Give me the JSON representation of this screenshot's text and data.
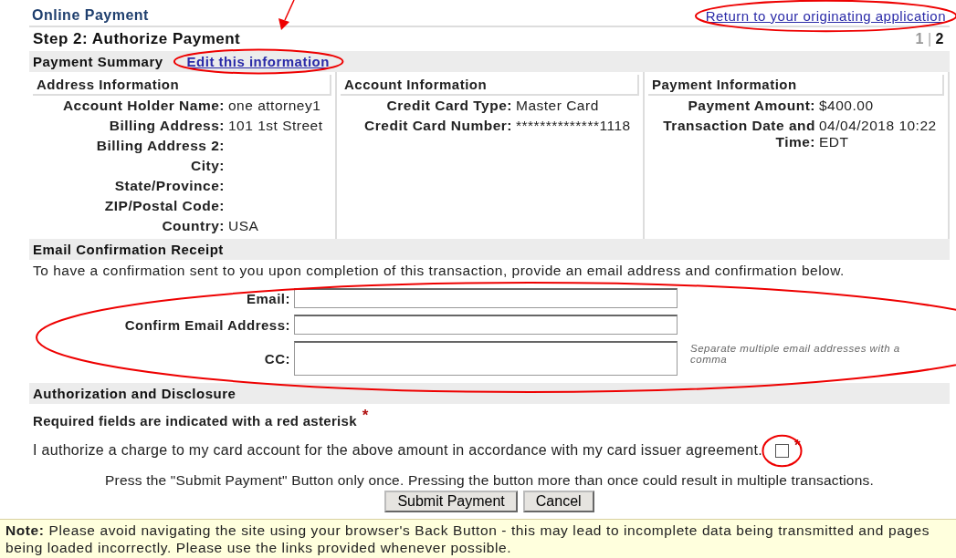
{
  "header": {
    "title": "Online Payment",
    "return_link": "Return to your originating application"
  },
  "step": {
    "title": "Step 2: Authorize Payment",
    "pager": [
      {
        "label": "1",
        "selected": false
      },
      {
        "label": "2",
        "selected": true
      }
    ],
    "separator": "|"
  },
  "summary": {
    "title": "Payment Summary",
    "edit_link": "Edit this information",
    "columns": [
      {
        "heading": "Address Information",
        "rows": [
          {
            "label": "Account Holder Name:",
            "value": "one attorney1"
          },
          {
            "label": "Billing Address:",
            "value": "101 1st Street"
          },
          {
            "label": "Billing Address 2:",
            "value": ""
          },
          {
            "label": "City:",
            "value": ""
          },
          {
            "label": "State/Province:",
            "value": ""
          },
          {
            "label": "ZIP/Postal Code:",
            "value": ""
          },
          {
            "label": "Country:",
            "value": "USA"
          }
        ]
      },
      {
        "heading": "Account Information",
        "rows": [
          {
            "label": "Credit Card Type:",
            "value": "Master Card"
          },
          {
            "label": "Credit Card Number:",
            "value": "**************1118"
          }
        ]
      },
      {
        "heading": "Payment Information",
        "rows": [
          {
            "label": "Payment Amount:",
            "value": "$400.00"
          },
          {
            "label": "Transaction Date and Time:",
            "value": "04/04/2018 10:22 EDT"
          }
        ]
      }
    ]
  },
  "email": {
    "title": "Email Confirmation Receipt",
    "intro": "To have a confirmation sent to you upon completion of this transaction, provide an email address and confirmation below.",
    "fields": [
      {
        "label": "Email:",
        "kind": "input"
      },
      {
        "label": "Confirm Email Address:",
        "kind": "input"
      },
      {
        "label": "CC:",
        "kind": "textarea",
        "hint": "Separate multiple email addresses with a comma"
      }
    ]
  },
  "authorization": {
    "title": "Authorization and Disclosure",
    "required_note": "Required fields are indicated with a red asterisk",
    "asterisk": "*",
    "agreement": {
      "text": "I authorize a charge to my card account for the above amount in accordance with my card issuer agreement.",
      "checked": false,
      "asterisk": "*"
    },
    "instruction": "Press the \"Submit Payment\" Button only once. Pressing the button more than once could result in multiple transactions.",
    "buttons": [
      "Submit Payment",
      "Cancel"
    ]
  },
  "note": {
    "label": "Note:",
    "text": "Please avoid navigating the site using your browser's Back Button - this may lead to incomplete data being transmitted and pages being loaded incorrectly. Please use the links provided whenever possible."
  }
}
